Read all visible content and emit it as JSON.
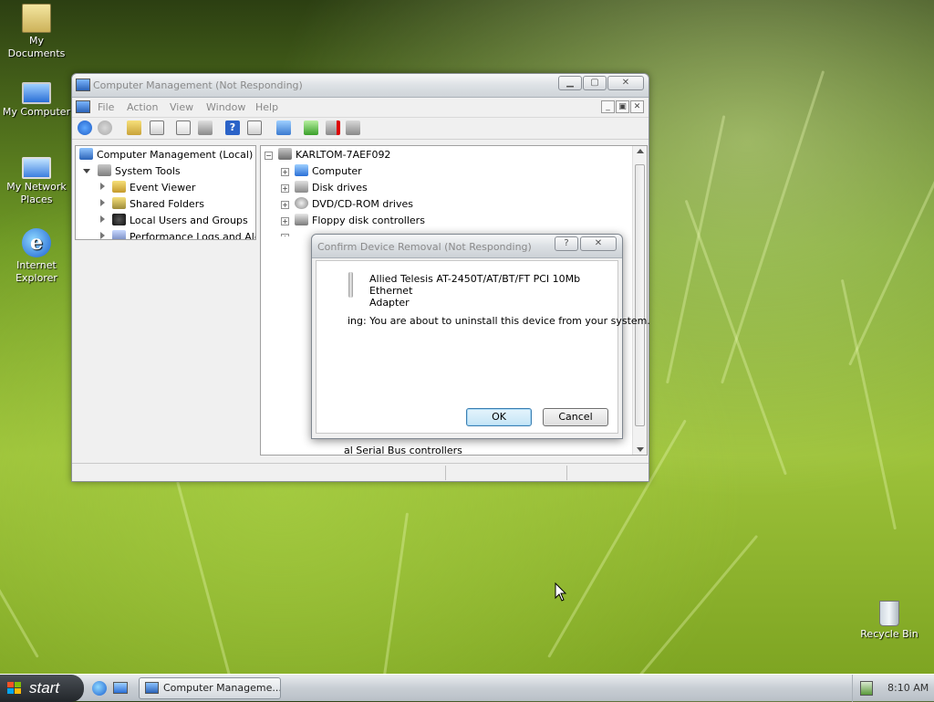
{
  "desktop": {
    "icons": [
      {
        "label": "My Documents"
      },
      {
        "label": "My Computer"
      },
      {
        "label": "My Network Places"
      },
      {
        "label": "Internet Explorer"
      },
      {
        "label": "Recycle Bin"
      }
    ]
  },
  "window": {
    "title": "Computer Management (Not Responding)",
    "menu": [
      "File",
      "Action",
      "View",
      "Window",
      "Help"
    ],
    "left_tree": [
      {
        "label": "Computer Management (Local)"
      },
      {
        "label": "System Tools"
      },
      {
        "label": "Event Viewer"
      },
      {
        "label": "Shared Folders"
      },
      {
        "label": "Local Users and Groups"
      },
      {
        "label": "Performance Logs and Alert"
      }
    ],
    "right_tree": [
      {
        "label": "KARLTOM-7AEF092"
      },
      {
        "label": "Computer"
      },
      {
        "label": "Disk drives"
      },
      {
        "label": "DVD/CD-ROM drives"
      },
      {
        "label": "Floppy disk controllers"
      },
      {
        "label": "al Serial Bus controllers"
      }
    ]
  },
  "dialog": {
    "title": "Confirm Device Removal (Not Responding)",
    "device_line1": "Allied Telesis AT-2450T/AT/BT/FT PCI 10Mb Ethernet",
    "device_line2": "Adapter",
    "warning": "ing: You are about to uninstall this device from your system.",
    "ok_label": "OK",
    "cancel_label": "Cancel",
    "help_glyph": "?",
    "close_glyph": "✕"
  },
  "taskbar": {
    "start_label": "start",
    "task_label": "Computer Manageme...",
    "clock": "8:10 AM"
  },
  "colors": {
    "accent": "#3c7fb1"
  }
}
